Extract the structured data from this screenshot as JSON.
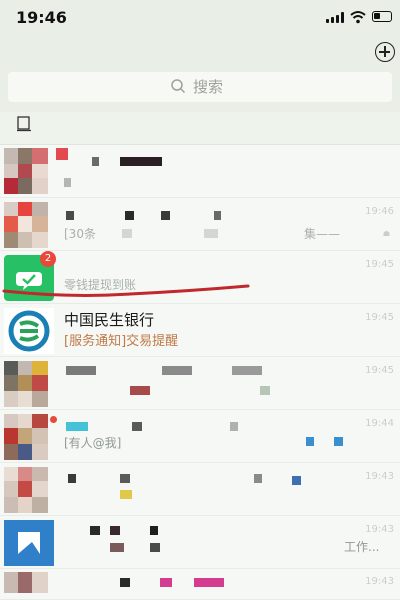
{
  "status_bar": {
    "time": "19:46"
  },
  "search": {
    "label": "搜索"
  },
  "chats": [
    {
      "time": "",
      "preview": ""
    },
    {
      "time": "19:46",
      "preview": "[30条",
      "preview_tail": "集——"
    },
    {
      "time": "19:45",
      "title": "",
      "preview": "零钱提现到账",
      "badge": "2"
    },
    {
      "time": "19:45",
      "title": "中国民生银行",
      "tag": "[服务通知]",
      "preview": "交易提醒"
    },
    {
      "time": "19:45",
      "preview": ""
    },
    {
      "time": "19:44",
      "preview": "[有人@我]"
    },
    {
      "time": "19:43",
      "preview": ""
    },
    {
      "time": "19:43",
      "preview_tail": "工作..."
    },
    {
      "time": "19:43",
      "preview": ""
    }
  ],
  "colors": {
    "wechat_green": "#27c064",
    "badge_red": "#e8493b",
    "ink_red": "#c0282d",
    "tag_orange": "#c07a48"
  }
}
